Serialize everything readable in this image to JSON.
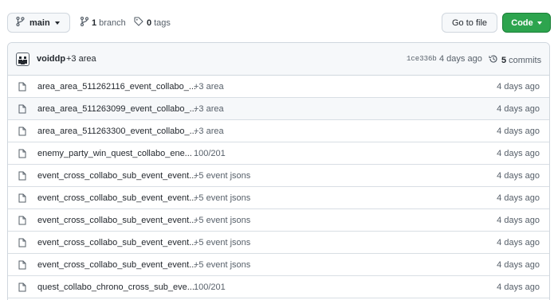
{
  "toolbar": {
    "branch_label": "main",
    "branch_count": "1",
    "branch_word": "branch",
    "tag_count": "0",
    "tag_word": "tags",
    "goto_label": "Go to file",
    "code_label": "Code"
  },
  "latest_commit": {
    "author": "voiddp",
    "message": "+3 area",
    "sha": "1ce336b",
    "age": "4 days ago",
    "commit_count": "5",
    "commit_word": "commits"
  },
  "files": [
    {
      "name": "area_area_511262116_event_collabo_...",
      "message": "+3 area",
      "age": "4 days ago"
    },
    {
      "name": "area_area_511263099_event_collabo_...",
      "message": "+3 area",
      "age": "4 days ago"
    },
    {
      "name": "area_area_511263300_event_collabo_...",
      "message": "+3 area",
      "age": "4 days ago"
    },
    {
      "name": "enemy_party_win_quest_collabo_ene...",
      "message": "100/201",
      "age": "4 days ago"
    },
    {
      "name": "event_cross_collabo_sub_event_event...",
      "message": "+5 event jsons",
      "age": "4 days ago"
    },
    {
      "name": "event_cross_collabo_sub_event_event...",
      "message": "+5 event jsons",
      "age": "4 days ago"
    },
    {
      "name": "event_cross_collabo_sub_event_event...",
      "message": "+5 event jsons",
      "age": "4 days ago"
    },
    {
      "name": "event_cross_collabo_sub_event_event...",
      "message": "+5 event jsons",
      "age": "4 days ago"
    },
    {
      "name": "event_cross_collabo_sub_event_event...",
      "message": "+5 event jsons",
      "age": "4 days ago"
    },
    {
      "name": "quest_collabo_chrono_cross_sub_eve...",
      "message": "100/201",
      "age": "4 days ago"
    }
  ],
  "icons": {
    "branch": "git-branch-icon",
    "tag": "tag-icon",
    "history": "history-icon",
    "file": "file-icon"
  },
  "colors": {
    "code_button": "#2da44e",
    "row_hover": "#f6f8fa",
    "border": "#d0d7de"
  }
}
